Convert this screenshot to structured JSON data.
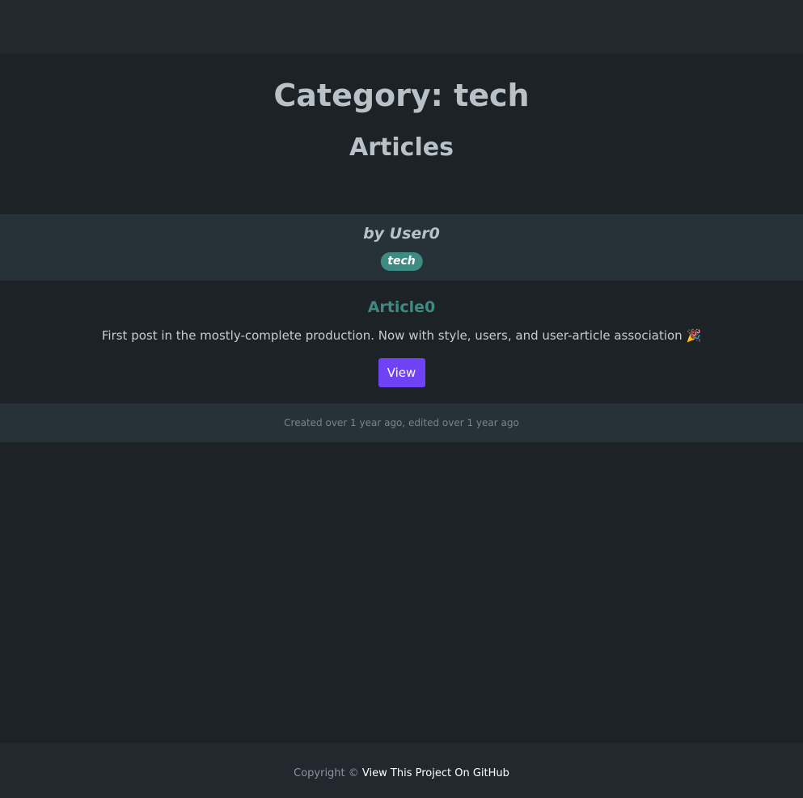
{
  "header": {
    "title": "Category: tech",
    "subtitle": "Articles"
  },
  "article": {
    "author": "by User0",
    "tag": "tech",
    "title": "Article0",
    "description": "First post in the mostly-complete production. Now with style, users, and user-article association 🎉",
    "view_label": "View",
    "meta": "Created over 1 year ago, edited over 1 year ago"
  },
  "footer": {
    "copyright": "Copyright © ",
    "link_label": "View This Project On GitHub"
  },
  "colors": {
    "accent": "#3d8b82",
    "button": "#6f42f5",
    "background": "#1d2226"
  }
}
